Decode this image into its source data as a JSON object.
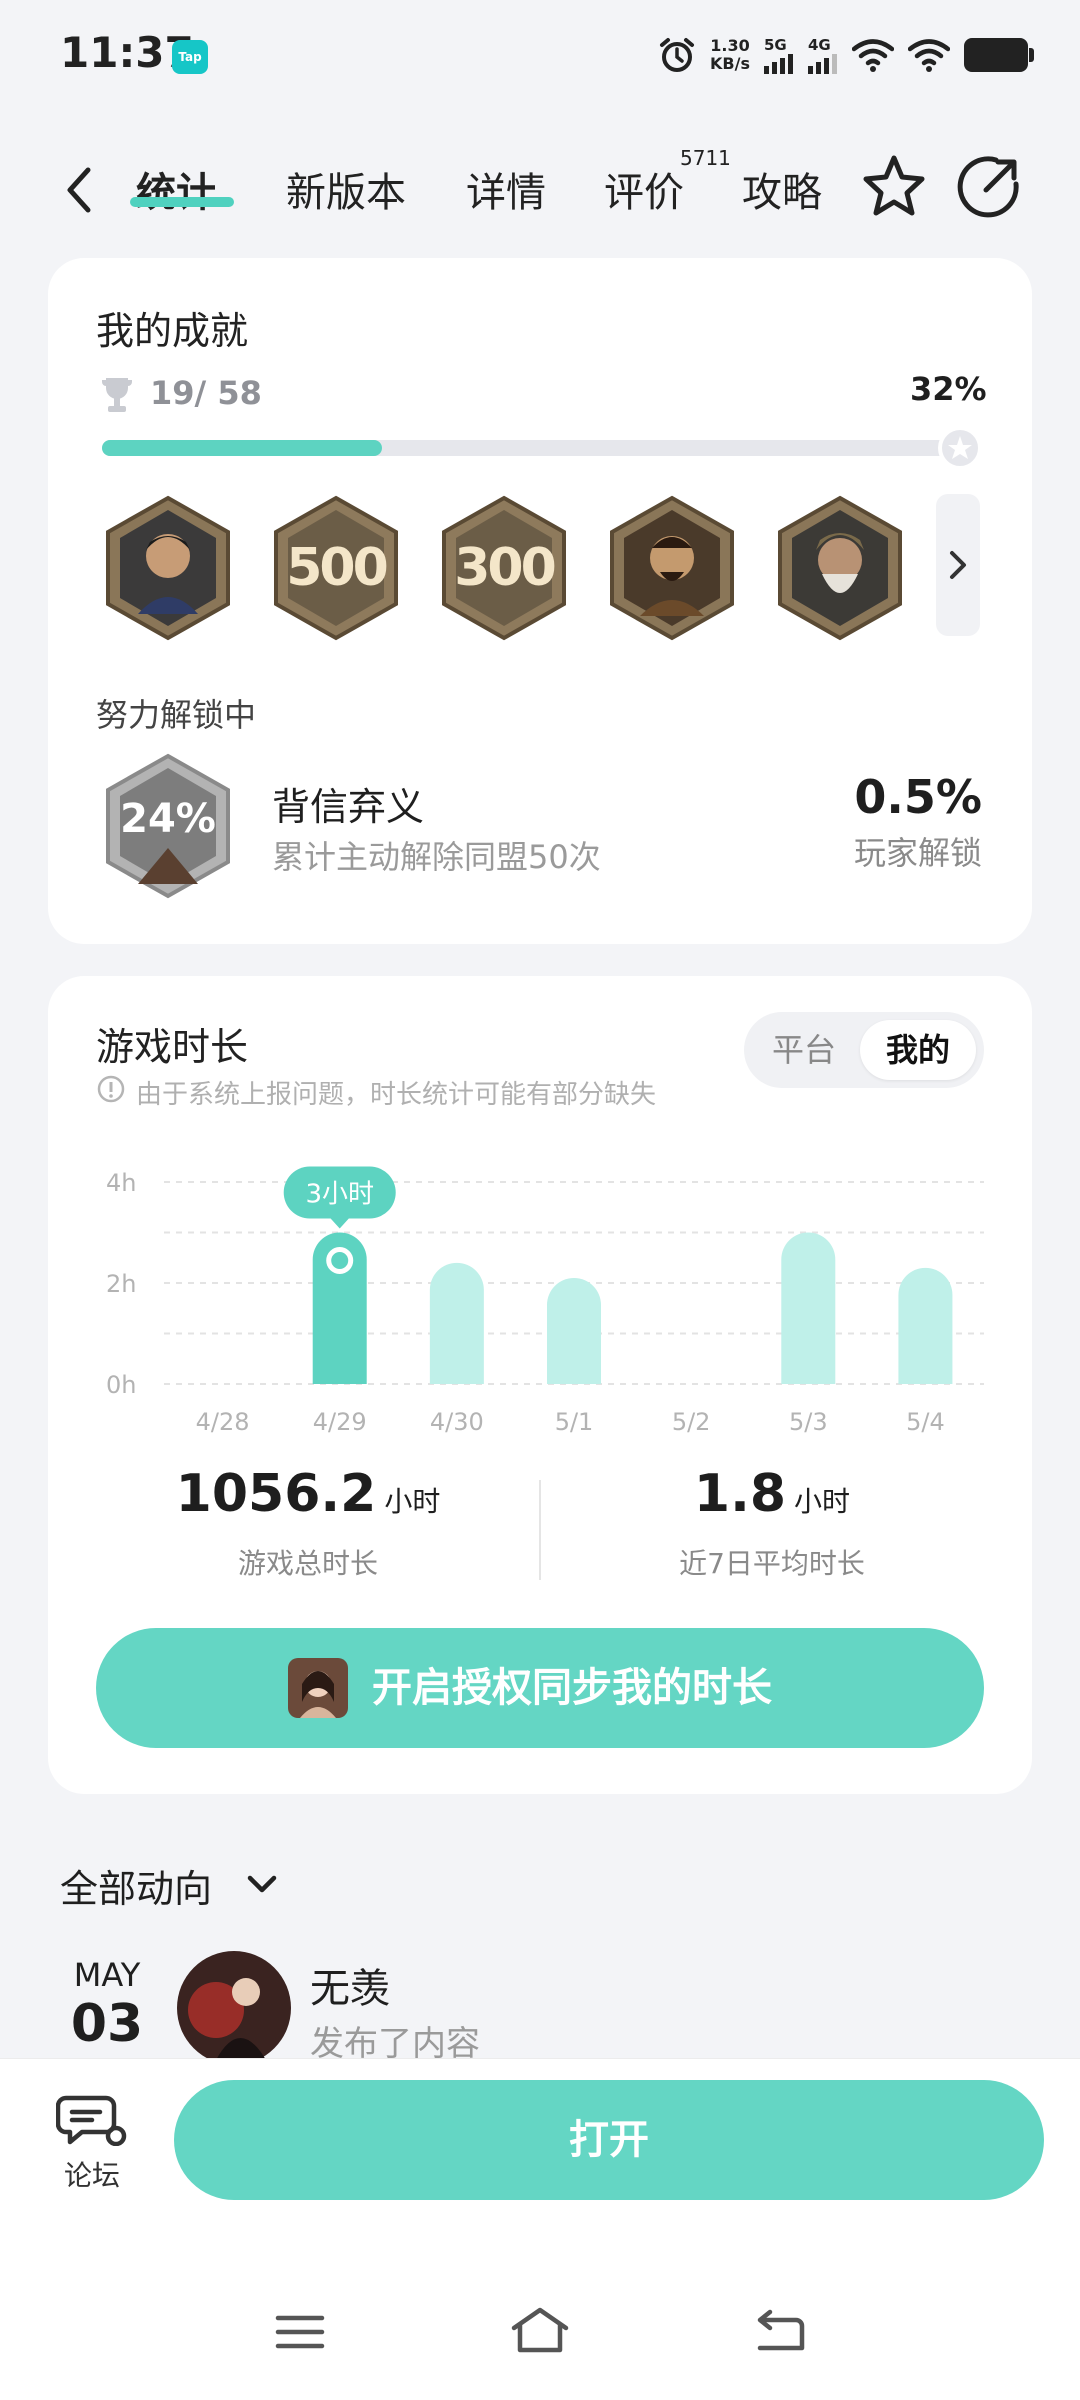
{
  "status_bar": {
    "time": "11:37",
    "app_badge": "Tap",
    "speed_value": "1.30",
    "speed_unit": "KB/s",
    "net_5g": "5G",
    "net_4g": "4G"
  },
  "nav": {
    "tabs": [
      {
        "label": "统计",
        "active": true
      },
      {
        "label": "新版本",
        "active": false
      },
      {
        "label": "详情",
        "active": false
      },
      {
        "label": "评价",
        "active": false
      },
      {
        "label": "攻略",
        "active": false
      }
    ],
    "review_count": "5711",
    "icons": [
      "back-arrow-icon",
      "star-icon",
      "share-icon"
    ]
  },
  "achievements": {
    "title": "我的成就",
    "count": "19/ 58",
    "percent_label": "32%",
    "progress": 0.32,
    "badges": [
      {
        "type": "portrait",
        "text": ""
      },
      {
        "type": "number",
        "text": "500"
      },
      {
        "type": "number",
        "text": "300"
      },
      {
        "type": "portrait",
        "text": ""
      },
      {
        "type": "portrait",
        "text": ""
      }
    ],
    "unlocking_title": "努力解锁中",
    "unlocking": {
      "badge_text": "24%",
      "name": "背信弃义",
      "desc": "累计主动解除同盟50次",
      "rate": "0.5%",
      "rate_label": "玩家解锁"
    }
  },
  "playtime": {
    "title": "游戏时长",
    "notice": "由于系统上报问题，时长统计可能有部分缺失",
    "segments": [
      {
        "label": "平台",
        "active": false
      },
      {
        "label": "我的",
        "active": true
      }
    ],
    "tooltip": "3小时",
    "total_value": "1056.2",
    "total_unit": "小时",
    "total_label": "游戏总时长",
    "avg_value": "1.8",
    "avg_unit": "小时",
    "avg_label": "近7日平均时长",
    "sync_button": "开启授权同步我的时长"
  },
  "chart_data": {
    "type": "bar",
    "categories": [
      "4/28",
      "4/29",
      "4/30",
      "5/1",
      "5/2",
      "5/3",
      "5/4"
    ],
    "values": [
      0,
      3.0,
      2.4,
      2.1,
      0,
      3.0,
      2.3
    ],
    "ylim": [
      0,
      4
    ],
    "y_ticks": [
      "4h",
      "2h",
      "0h"
    ],
    "highlighted_index": 1,
    "grid": true,
    "colors": {
      "highlight": "#5dd3c1",
      "normal": "#bff0e9"
    }
  },
  "feed": {
    "filter_label": "全部动向",
    "item": {
      "month": "MAY",
      "day": "03",
      "name": "无羡",
      "action": "发布了内容"
    }
  },
  "bottom": {
    "forum_label": "论坛",
    "open_button": "打开"
  },
  "colors": {
    "accent": "#5dd3c1",
    "accent_button": "#64d6c4",
    "background": "#f3f4f7"
  }
}
